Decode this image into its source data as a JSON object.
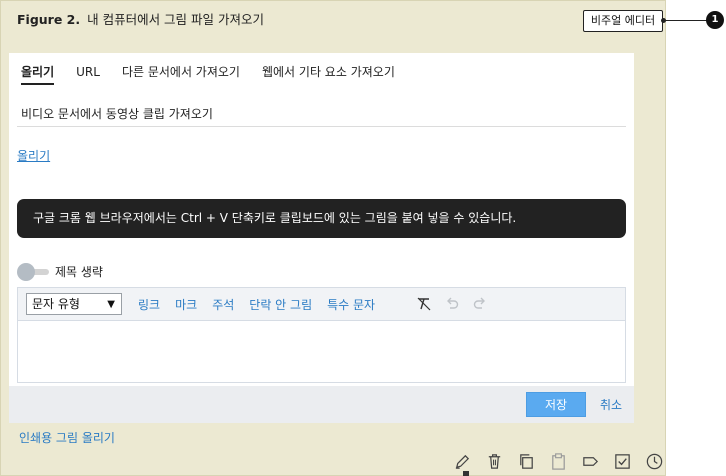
{
  "figure": {
    "label": "Figure 2.",
    "title": "내 컴퓨터에서 그림 파일 가져오기"
  },
  "callout": {
    "tag": "비주얼 에디터",
    "number": "1"
  },
  "tabs": [
    "올리기",
    "URL",
    "다른 문서에서 가져오기",
    "웹에서 기타 요소 가져오기"
  ],
  "subtab": "비디오 문서에서 동영상 클립 가져오기",
  "upload_link": "올리기",
  "toast": "구글 크롬 웹 브라우저에서는 Ctrl + V 단축키로 클립보드에 있는 그림을 붙여 넣을 수 있습니다.",
  "caption_toggle": {
    "label": "제목 생략",
    "enabled": false
  },
  "editor": {
    "style_select": "문자 유형",
    "toolbar": [
      "링크",
      "마크",
      "주석",
      "단락 안 그림",
      "특수 문자"
    ],
    "icons": [
      "clear-format-icon",
      "undo-icon",
      "redo-icon"
    ]
  },
  "actions": {
    "save": "저장",
    "cancel": "취소"
  },
  "print_upload": "인쇄용 그림 올리기",
  "bottom_icons": [
    "pencil-icon",
    "trash-icon",
    "copy-icon",
    "clipboard-icon",
    "tag-icon",
    "checkbox-icon",
    "clock-icon"
  ],
  "colors": {
    "frame": "#ece9d2",
    "link": "#2a7bc4",
    "save_button": "#5aaaf0",
    "toast": "#222222"
  }
}
